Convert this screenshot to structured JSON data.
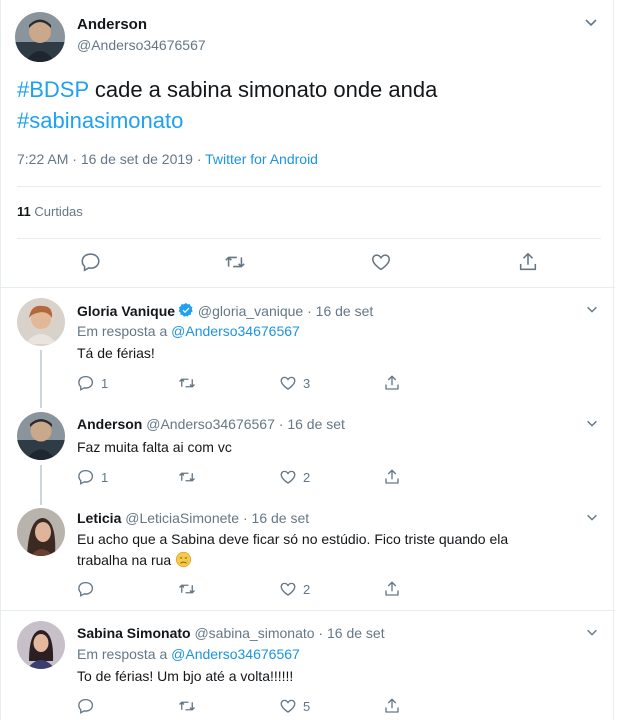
{
  "main_tweet": {
    "author_name": "Anderson",
    "author_handle": "@Anderso34676567",
    "hashtag1": "#BDSP",
    "text_rest": " cade a sabina simonato onde anda",
    "hashtag2": "#sabinasimonato",
    "time": "7:22 AM",
    "date": "16 de set de 2019",
    "source": "Twitter for Android",
    "likes_count": "11",
    "likes_label": "Curtidas",
    "meta_dot": " · "
  },
  "replies": [
    {
      "name": "Gloria Vanique",
      "verified": true,
      "handle": "@gloria_vanique",
      "date": "16 de set",
      "reply_prefix": "Em resposta a",
      "reply_to": "@Anderso34676567",
      "text": "Tá de férias!",
      "replies": "1",
      "likes": "3"
    },
    {
      "name": "Anderson",
      "handle": "@Anderso34676567",
      "date": "16 de set",
      "text": "Faz muita falta ai com vc",
      "replies": "1",
      "likes": "2"
    },
    {
      "name": "Leticia",
      "handle": "@LeticiaSimonete",
      "date": "16 de set",
      "text": "Eu acho que a Sabina deve ficar só no estúdio. Fico triste quando ela trabalha na rua",
      "emoji": "sad-face-emoji",
      "replies": "",
      "likes": "2"
    },
    {
      "name": "Sabina Simonato",
      "handle": "@sabina_simonato",
      "date": "16 de set",
      "reply_prefix": "Em resposta a",
      "reply_to": "@Anderso34676567",
      "text": "To de férias! Um bjo até a volta!!!!!!",
      "replies": "",
      "likes": "5"
    }
  ],
  "colors": {
    "link": "#1da1f2",
    "muted": "#657786",
    "text": "#14171a",
    "border": "#e6ecf0",
    "verified": "#1da1f2"
  },
  "icons": [
    "chevron-down-icon",
    "reply-icon",
    "retweet-icon",
    "like-icon",
    "share-icon",
    "verified-badge-icon"
  ]
}
